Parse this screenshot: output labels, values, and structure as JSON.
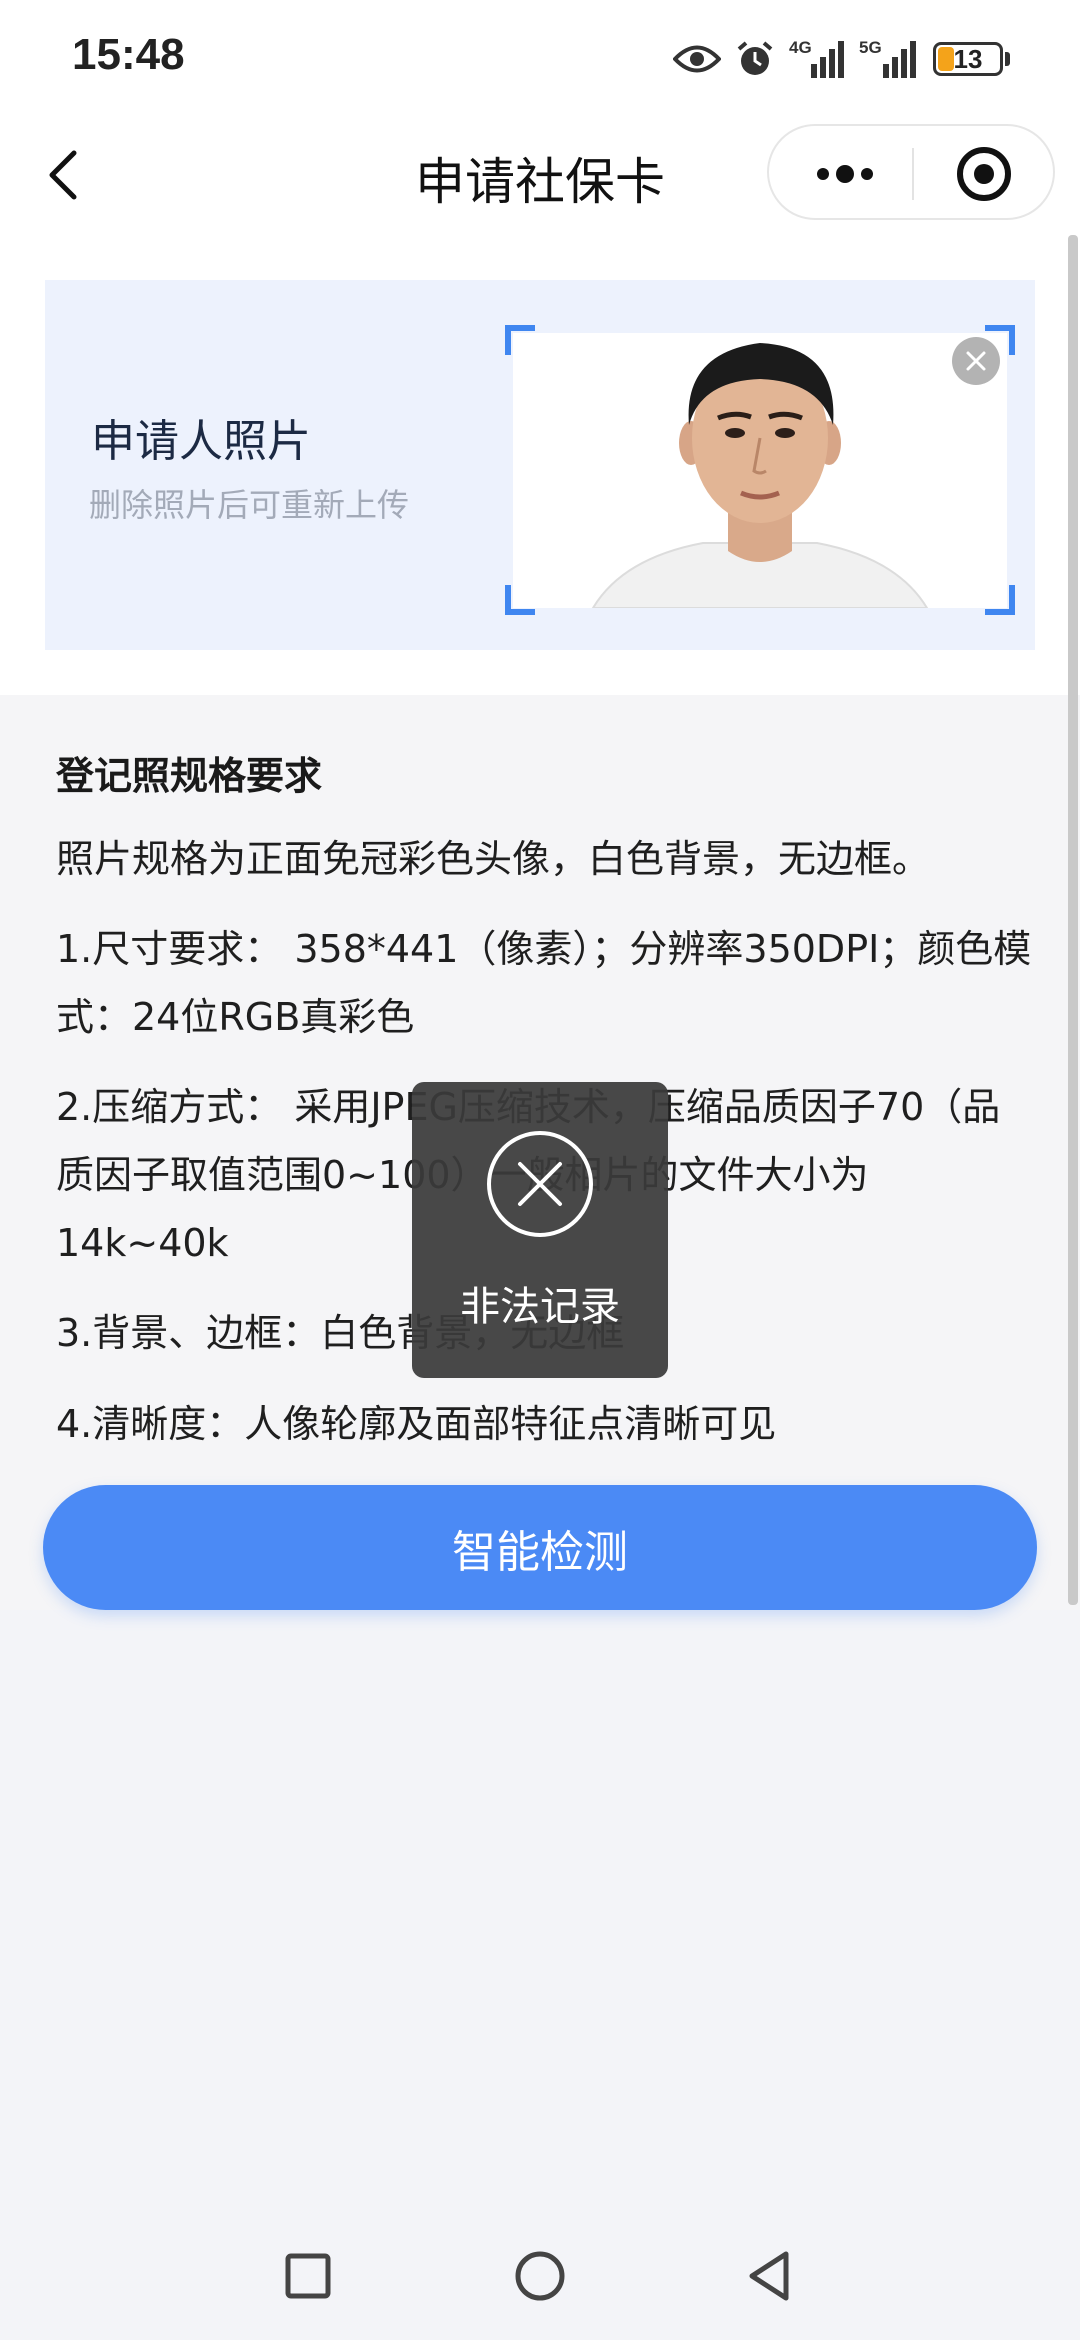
{
  "status_bar": {
    "time": "15:48",
    "icons": [
      "eye-icon",
      "alarm-icon",
      "signal-4g-icon",
      "signal-5g-icon"
    ],
    "network_1": "4G",
    "network_2": "5G",
    "battery": "13"
  },
  "nav": {
    "title": "申请社保卡",
    "back_icon": "chevron-left-icon",
    "more_icon": "more-dots-icon",
    "close_icon": "target-icon"
  },
  "photo_card": {
    "title": "申请人照片",
    "hint": "删除照片后可重新上传",
    "delete_icon": "close-circle-icon"
  },
  "spec": {
    "title": "登记照规格要求",
    "lines": [
      "照片规格为正面免冠彩色头像，白色背景，无边框。",
      "1.尺寸要求： 358*441（像素）；分辨率350DPI；颜色模式：24位RGB真彩色",
      "2.压缩方式： 采用JPEG压缩技术，压缩品质因子70（品质因子取值范围0~100）一般相片的文件大小为14k~40k",
      "3.背景、边框：白色背景，无边框",
      "4.清晰度：人像轮廓及面部特征点清晰可见"
    ]
  },
  "detect_button": "智能检测",
  "toast": {
    "text": "非法记录",
    "icon": "x-circle-icon"
  },
  "system_nav": [
    "square-icon",
    "circle-icon",
    "triangle-back-icon"
  ],
  "colors": {
    "accent": "#4b8af5",
    "frame_corner": "#3f86f0",
    "card_bg": "#edf2fd",
    "battery_fill": "#f4a31a"
  }
}
